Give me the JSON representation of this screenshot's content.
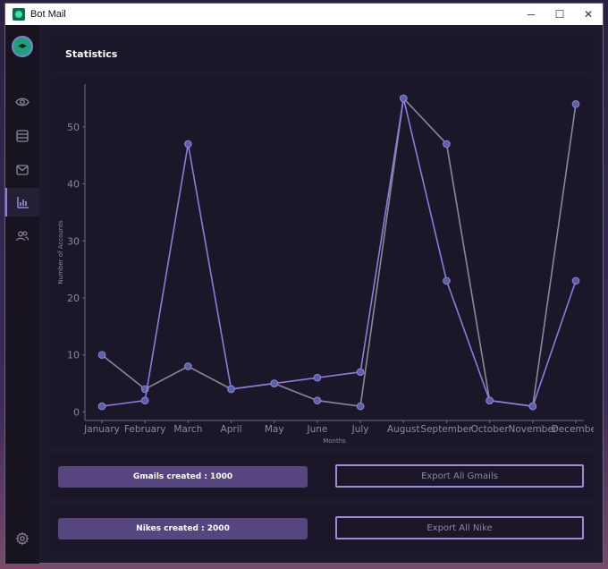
{
  "window": {
    "title": "Bot Mail",
    "controls": [
      "─",
      "☐",
      "✕"
    ]
  },
  "sidebar": {
    "items": [
      {
        "icon": "eye-icon"
      },
      {
        "icon": "database-icon"
      },
      {
        "icon": "mail-icon"
      },
      {
        "icon": "bar-chart-icon",
        "active": true
      },
      {
        "icon": "users-icon"
      }
    ],
    "footer_icon": "gear-icon"
  },
  "header": {
    "title": "Statistics"
  },
  "chart_data": {
    "type": "line",
    "categories": [
      "January",
      "February",
      "March",
      "April",
      "May",
      "June",
      "July",
      "August",
      "September",
      "October",
      "November",
      "December"
    ],
    "series": [
      {
        "color": "#8f7ae0",
        "values": [
          1,
          2,
          47,
          4,
          5,
          6,
          7,
          55,
          23,
          2,
          1,
          23
        ]
      },
      {
        "color": "#8b8796",
        "values": [
          10,
          4,
          8,
          4,
          5,
          2,
          1,
          55,
          47,
          2,
          1,
          54
        ]
      }
    ],
    "xlabel": "Months",
    "ylabel": "Number of Accounts",
    "yticks": [
      0,
      10,
      20,
      30,
      40,
      50
    ],
    "ylim": [
      -1.5,
      57.5
    ],
    "grid": false
  },
  "stats": {
    "gmails_label": "Gmails created : 1000",
    "gmails_button": "Export All Gmails",
    "nikes_label": "Nikes created : 2000",
    "nikes_button": "Export All Nike"
  }
}
